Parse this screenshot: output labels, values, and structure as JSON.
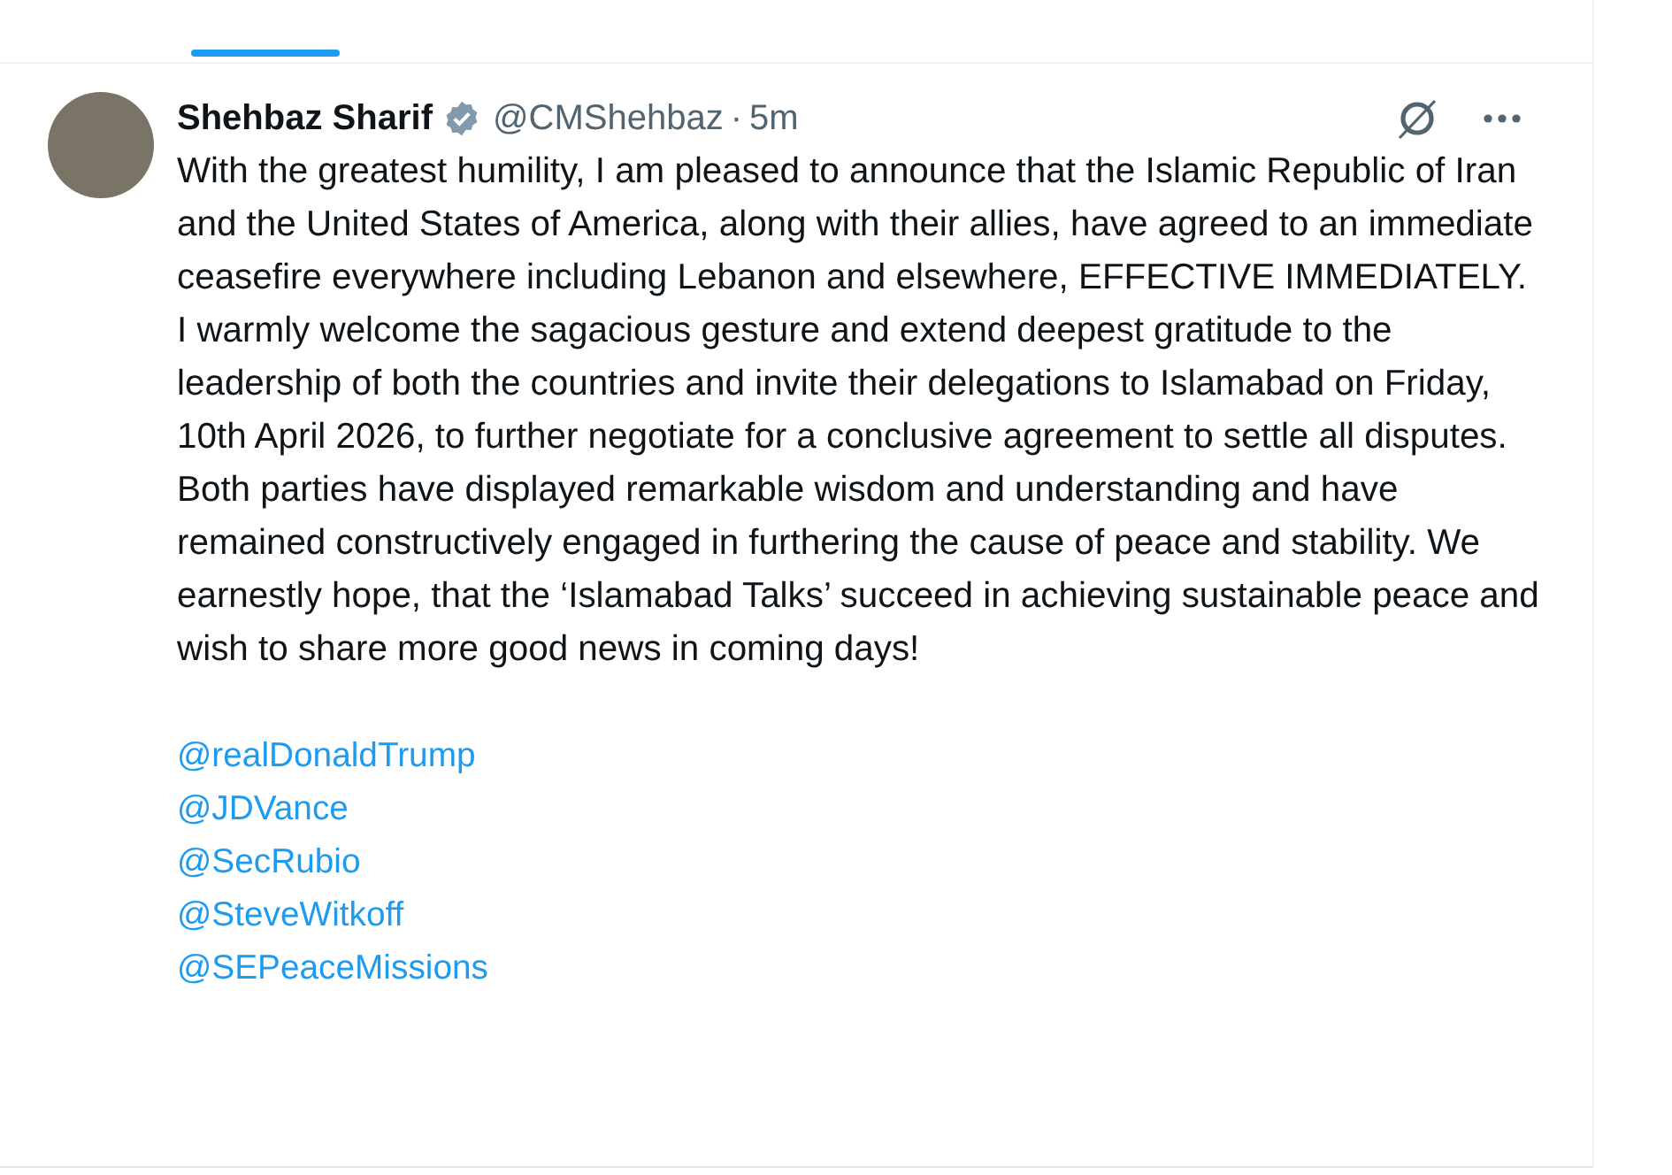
{
  "post": {
    "author": "Shehbaz Sharif",
    "verified": true,
    "handle": "@CMShehbaz",
    "separator": "·",
    "time": "5m",
    "paragraphs": [
      "With the greatest humility, I am pleased to announce that the Islamic Republic of Iran and the United States of America, along with their allies, have agreed to an immediate ceasefire everywhere including Lebanon and elsewhere, EFFECTIVE IMMEDIATELY.",
      "I warmly welcome the sagacious gesture and extend deepest gratitude to the leadership of both the countries and invite their delegations to Islamabad on Friday, 10th April 2026, to further negotiate for a conclusive agreement to settle all disputes.",
      "Both parties have displayed remarkable wisdom and understanding and have remained constructively engaged in furthering the cause of peace and stability. We earnestly hope, that the ‘Islamabad Talks’ succeed in achieving sustainable peace and wish to share more good news in coming days!"
    ],
    "mentions": [
      "@realDonaldTrump",
      "@JDVance",
      "@SecRubio",
      "@SteveWitkoff",
      "@SEPeaceMissions"
    ]
  }
}
